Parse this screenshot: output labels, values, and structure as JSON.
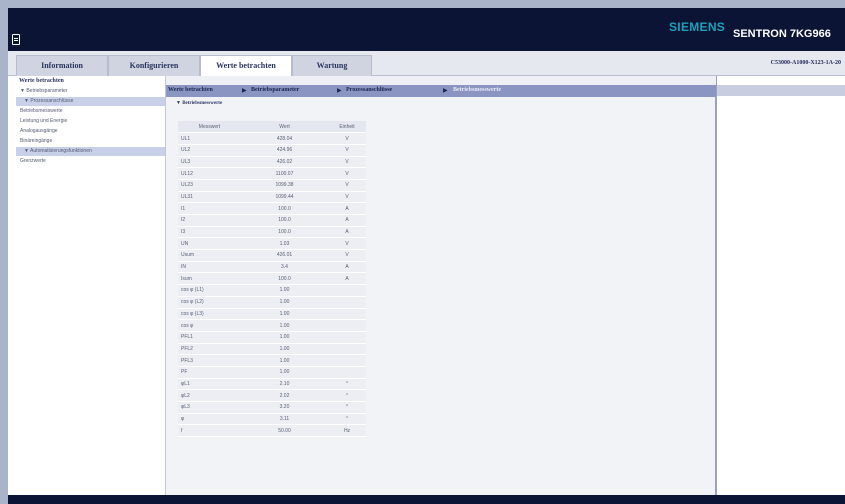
{
  "header": {
    "brand": "SIEMENS",
    "product": "SENTRON 7KG966"
  },
  "tabs": [
    {
      "label": "Information"
    },
    {
      "label": "Konfigurieren"
    },
    {
      "label": "Werte betrachten"
    },
    {
      "label": "Wartung"
    }
  ],
  "order_code": "C53000-A1000-X123-1A-20",
  "sidebar": {
    "title": "Werte betrachten",
    "items": [
      {
        "label": "▼ Betriebsparameter"
      },
      {
        "label": "▼ Prozessanschlüsse"
      },
      {
        "label": "Betriebsmesswerte"
      },
      {
        "label": "Leistung und Energie"
      },
      {
        "label": "Analogausgänge"
      },
      {
        "label": "Binäreingänge"
      },
      {
        "label": "▼ Automatisierungsfunktionen"
      },
      {
        "label": "Grenzwerte"
      }
    ]
  },
  "breadcrumb": {
    "items": [
      "Werte betrachten",
      "Betriebsparameter",
      "Prozessanschlüsse",
      "Betriebsmesswerte"
    ]
  },
  "panel": {
    "title": "▼ Betriebsmesswerte"
  },
  "table": {
    "headers": [
      "Messwert",
      "Wert",
      "Einheit"
    ],
    "rows": [
      [
        "UL1",
        "428.04",
        "V"
      ],
      [
        "UL2",
        "424.96",
        "V"
      ],
      [
        "UL3",
        "426.02",
        "V"
      ],
      [
        "UL12",
        "1100.07",
        "V"
      ],
      [
        "UL23",
        "1099.38",
        "V"
      ],
      [
        "UL31",
        "1099.44",
        "V"
      ],
      [
        "I1",
        "100.0",
        "A"
      ],
      [
        "I2",
        "100.0",
        "A"
      ],
      [
        "I3",
        "100.0",
        "A"
      ],
      [
        "UN",
        "1.03",
        "V"
      ],
      [
        "Usum",
        "426.01",
        "V"
      ],
      [
        "IN",
        "3.4",
        "A"
      ],
      [
        "Isum",
        "100.0",
        "A"
      ],
      [
        "cos φ (L1)",
        "1.00",
        ""
      ],
      [
        "cos φ (L2)",
        "1.00",
        ""
      ],
      [
        "cos φ (L3)",
        "1.00",
        ""
      ],
      [
        "cos φ",
        "1.00",
        ""
      ],
      [
        "PFL1",
        "1.00",
        ""
      ],
      [
        "PFL2",
        "1.00",
        ""
      ],
      [
        "PFL3",
        "1.00",
        ""
      ],
      [
        "PF",
        "1.00",
        ""
      ],
      [
        "φL1",
        "2.10",
        "°"
      ],
      [
        "φL2",
        "2.02",
        "°"
      ],
      [
        "φL3",
        "3.20",
        "°"
      ],
      [
        "φ",
        "3.11",
        "°"
      ],
      [
        "f",
        "50.00",
        "Hz"
      ]
    ]
  }
}
